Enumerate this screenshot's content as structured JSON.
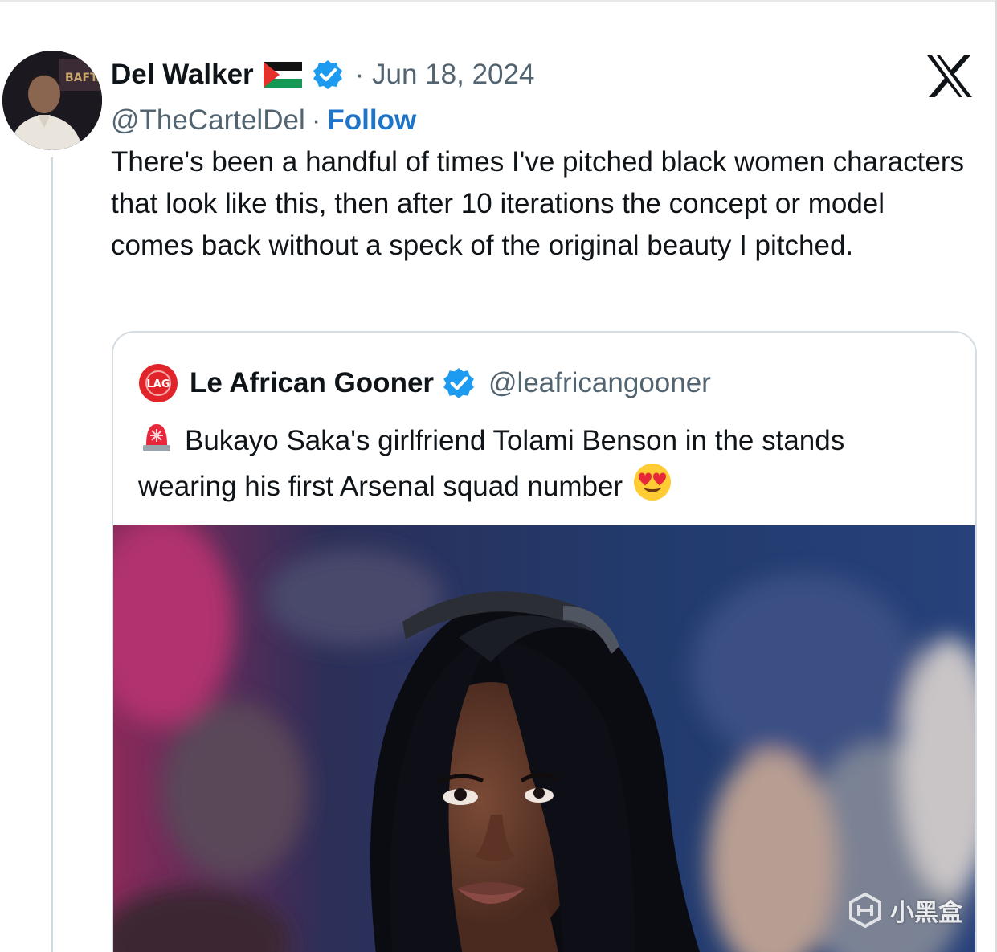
{
  "tweet": {
    "author": {
      "display_name": "Del Walker",
      "flag_icon": "palestine-flag-icon",
      "verified_icon": "verified-badge-icon",
      "handle": "@TheCartelDel"
    },
    "date_text": "· Jun 18, 2024",
    "separator": "·",
    "follow_label": "Follow",
    "platform_icon": "x-logo-icon",
    "text": "There's been a handful of times I've pitched black women characters that look like this, then after 10 iterations the concept or model comes back without a speck of the original beauty I pitched."
  },
  "quoted_tweet": {
    "author": {
      "display_name": "Le African Gooner",
      "verified_icon": "verified-badge-icon",
      "handle": "@leafricangooner"
    },
    "leading_emoji_icon": "rotating-light-icon",
    "text": "Bukayo Saka's girlfriend Tolami Benson in the stands wearing his first Arsenal squad number",
    "trailing_emoji_icon": "smiling-face-with-heart-eyes-icon",
    "media": {
      "type": "photo"
    }
  },
  "watermark": {
    "logo_icon": "xiaoheihe-logo-icon",
    "text": "小黑盒"
  },
  "colors": {
    "text_primary": "#0f1419",
    "text_secondary": "#536471",
    "link_blue": "#1d74c9",
    "verified_blue": "#1d9bf0",
    "border": "#d5dde2",
    "thread_line": "#cfd9de"
  }
}
